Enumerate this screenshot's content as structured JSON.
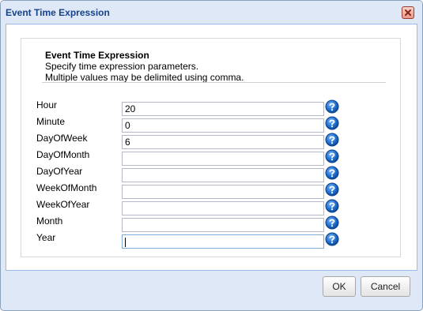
{
  "dialog": {
    "title": "Event Time Expression",
    "close_icon": "close-icon",
    "header": {
      "title": "Event Time Expression",
      "line1": "Specify time expression parameters.",
      "line2": "Multiple values may be delimited using comma."
    },
    "fields": [
      {
        "label": "Hour",
        "value": "20"
      },
      {
        "label": "Minute",
        "value": "0"
      },
      {
        "label": "DayOfWeek",
        "value": "6"
      },
      {
        "label": "DayOfMonth",
        "value": ""
      },
      {
        "label": "DayOfYear",
        "value": ""
      },
      {
        "label": "WeekOfMonth",
        "value": ""
      },
      {
        "label": "WeekOfYear",
        "value": ""
      },
      {
        "label": "Month",
        "value": ""
      },
      {
        "label": "Year",
        "value": ""
      }
    ],
    "help_icon": "help-icon",
    "buttons": {
      "ok": "OK",
      "cancel": "Cancel"
    }
  },
  "colors": {
    "frame": "#dfe8f6",
    "title_text": "#15428b",
    "help_blue": "#1c6fd1",
    "close_red": "#c9503c"
  }
}
